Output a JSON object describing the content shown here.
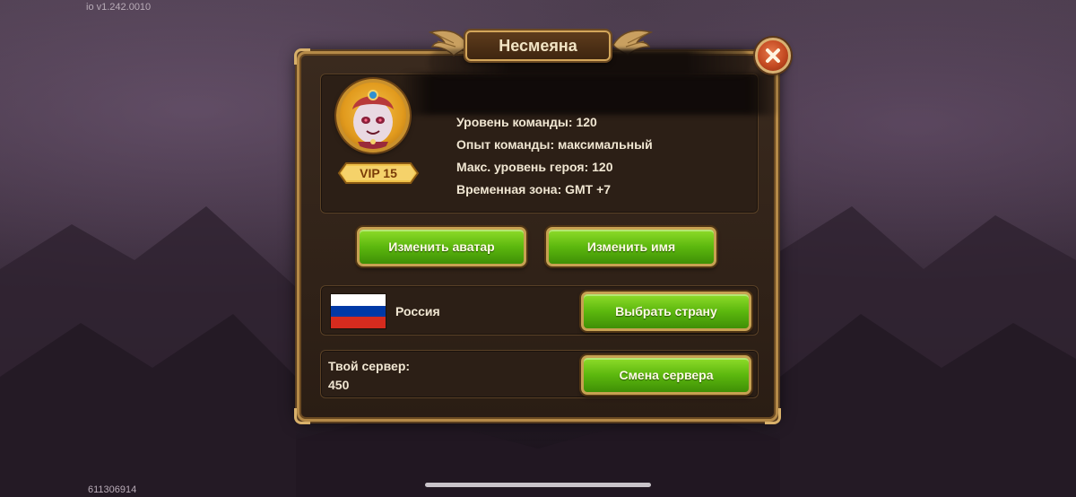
{
  "overlay": {
    "version": "io v1.242.0010",
    "user_id": "611306914"
  },
  "dialog": {
    "title": "Несмеяна",
    "close_icon": "close-x-icon"
  },
  "profile": {
    "avatar_icon": "hero-portrait-icon",
    "vip_label": "VIP 15",
    "stats": [
      "Уровень команды: 120",
      "Опыт команды: максимальный",
      "Макс. уровень героя: 120",
      "Временная зона: GMT +7"
    ]
  },
  "actions": {
    "change_avatar": "Изменить аватар",
    "change_name": "Изменить имя"
  },
  "country": {
    "flag_icon": "russia-flag-icon",
    "flag_colors": [
      "#ffffff",
      "#0039a6",
      "#d52b1e"
    ],
    "name": "Россия",
    "select_button": "Выбрать страну"
  },
  "server": {
    "label": "Твой сервер:",
    "value": "450",
    "change_button": "Смена сервера"
  },
  "colors": {
    "button_green": "#5cb80e",
    "frame_gold": "#b58a48",
    "close_red": "#c44a22"
  }
}
